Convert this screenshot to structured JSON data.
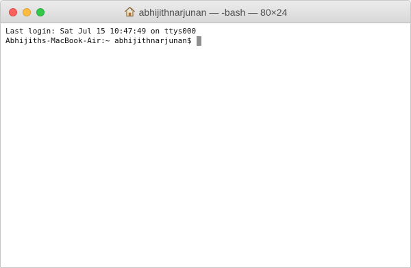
{
  "window": {
    "title": "abhijithnarjunan — -bash — 80×24",
    "title_icon": "home-icon"
  },
  "terminal": {
    "lines": [
      "Last login: Sat Jul 15 10:47:49 on ttys000",
      "Abhijiths-MacBook-Air:~ abhijithnarjunan$"
    ],
    "cursor_color": "#8f8f8f"
  },
  "colors": {
    "close": "#fc605c",
    "minimize": "#fdbc40",
    "zoom": "#34c84a"
  }
}
